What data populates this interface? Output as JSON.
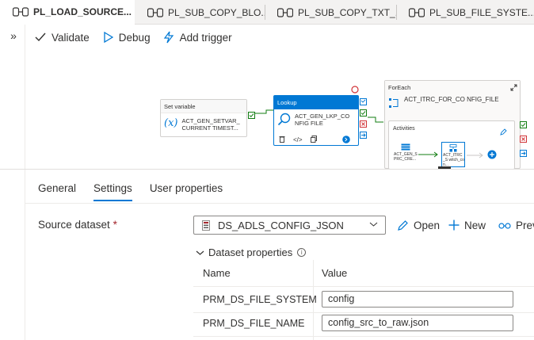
{
  "tabs": [
    {
      "label": "PL_LOAD_SOURCE...",
      "active": true,
      "close": "×"
    },
    {
      "label": "PL_SUB_COPY_BLO...",
      "active": false
    },
    {
      "label": "PL_SUB_COPY_TXT_...",
      "active": false
    },
    {
      "label": "PL_SUB_FILE_SYSTE...",
      "active": false
    }
  ],
  "sidebar": {
    "expand_glyph": "»"
  },
  "toolbar": {
    "validate_label": "Validate",
    "debug_label": "Debug",
    "add_trigger_label": "Add trigger"
  },
  "canvas": {
    "set_variable": {
      "type": "Set variable",
      "name": "ACT_GEN_SETVAR_ CURRENT TIMEST...",
      "icon_text": "(x)"
    },
    "lookup": {
      "type": "Lookup",
      "name": "ACT_GEN_LKP_CO NFIG FILE",
      "delete_glyph": "🗑",
      "code_glyph": "</>",
      "copy_glyph": "❐",
      "go_glyph": "→"
    },
    "foreach": {
      "type": "ForEach",
      "name": "ACT_ITRC_FOR_CO NFIG_FILE",
      "activities_label": "Activities",
      "inner_activity_1": "ACT_GEN_S PRC_CRE...",
      "inner_activity_2": "ACT_ITRC_S witch_con..."
    },
    "colors": {
      "accent": "#0078d4",
      "success": "#107c10",
      "fail": "#d13438"
    }
  },
  "detail_tabs": [
    {
      "label": "General",
      "active": false
    },
    {
      "label": "Settings",
      "active": true
    },
    {
      "label": "User properties",
      "active": false
    }
  ],
  "settings": {
    "source_dataset_label": "Source dataset",
    "required_mark": "*",
    "dataset_value": "DS_ADLS_CONFIG_JSON",
    "open_label": "Open",
    "new_label": "New",
    "preview_label": "Prev",
    "dataset_properties_label": "Dataset properties",
    "info_glyph": "i",
    "columns": {
      "name": "Name",
      "value": "Value"
    },
    "rows": [
      {
        "name": "PRM_DS_FILE_SYSTEM",
        "value": "config"
      },
      {
        "name": "PRM_DS_FILE_NAME",
        "value": "config_src_to_raw.json"
      }
    ]
  }
}
